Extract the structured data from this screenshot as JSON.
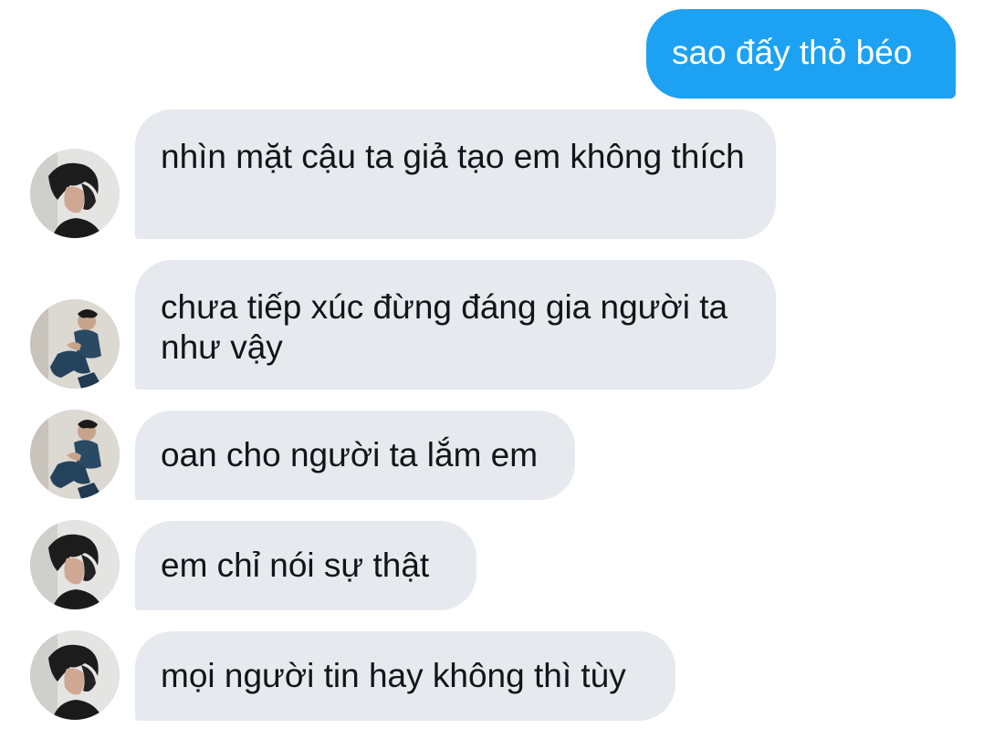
{
  "messages": [
    {
      "direction": "outgoing",
      "text": "sao đấy thỏ béo"
    },
    {
      "direction": "incoming",
      "avatar": "avatar-face-photo",
      "text": "nhìn mặt cậu ta giả tạo em không thích"
    },
    {
      "direction": "incoming",
      "avatar": "avatar-sitting-photo",
      "text": "chưa tiếp xúc đừng đáng gia người ta như vậy"
    },
    {
      "direction": "incoming",
      "avatar": "avatar-sitting-photo",
      "text": "oan cho người ta lắm em"
    },
    {
      "direction": "incoming",
      "avatar": "avatar-face-photo",
      "text": "em chỉ nói sự thật"
    },
    {
      "direction": "incoming",
      "avatar": "avatar-face-photo",
      "text": "mọi người tin hay không thì tùy"
    }
  ],
  "colors": {
    "outgoing_bubble": "#1da1f2",
    "incoming_bubble": "#e6eaee",
    "text": "#111418"
  }
}
